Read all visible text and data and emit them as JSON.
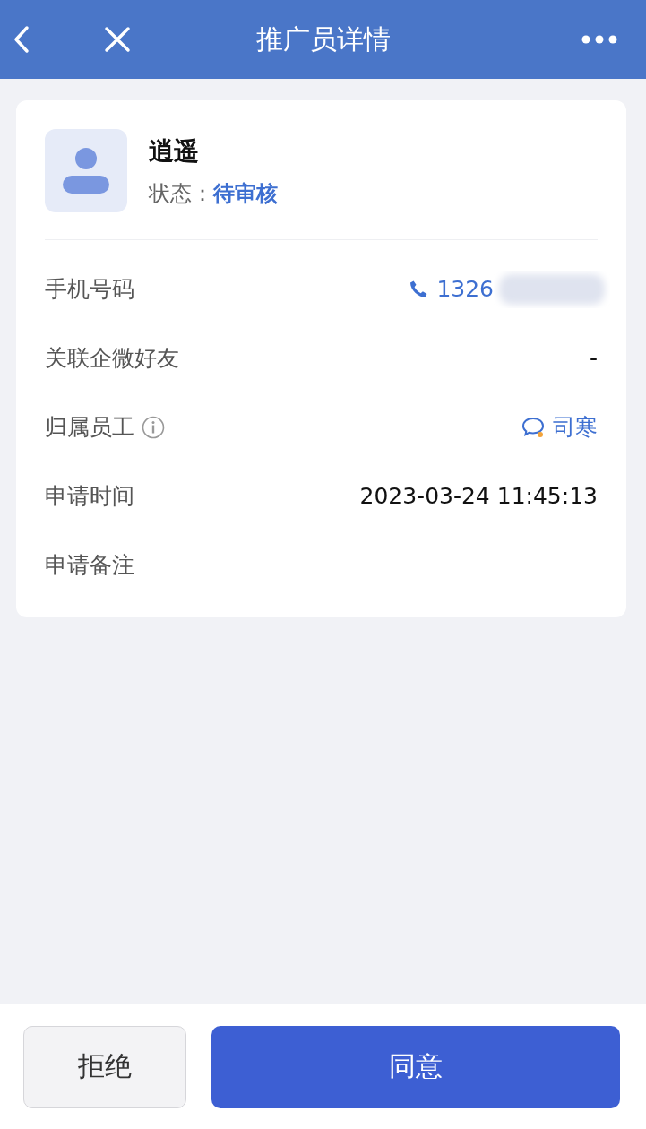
{
  "header": {
    "title": "推广员详情"
  },
  "profile": {
    "name": "逍遥",
    "status_label": "状态：",
    "status": "待审核"
  },
  "fields": [
    {
      "kind": "phone",
      "label": "手机号码",
      "value": "1326"
    },
    {
      "kind": "plain",
      "label": "关联企微好友",
      "value": "-"
    },
    {
      "kind": "employee",
      "label": "归属员工",
      "value": "司寒",
      "info": true
    },
    {
      "kind": "plain",
      "label": "申请时间",
      "value": "2023-03-24 11:45:13"
    },
    {
      "kind": "plain",
      "label": "申请备注"
    }
  ],
  "buttons": [
    {
      "kind": "secondary",
      "label": "拒绝"
    },
    {
      "kind": "primary",
      "label": "同意"
    }
  ]
}
